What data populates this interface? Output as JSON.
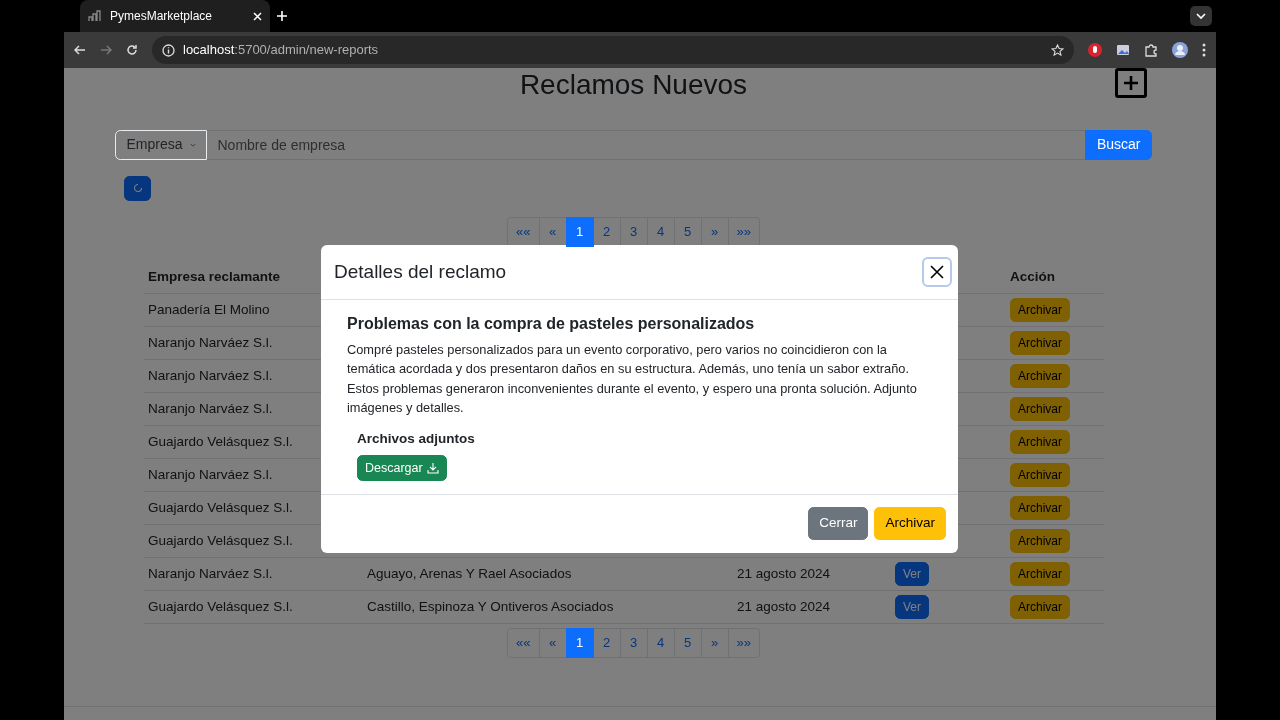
{
  "browser": {
    "tab_title": "PymesMarketplace",
    "url_host": "localhost",
    "url_path": ":5700/admin/new-reports"
  },
  "page": {
    "title": "Reclamos Nuevos",
    "search": {
      "filter": "Empresa",
      "placeholder": "Nombre de empresa",
      "button": "Buscar"
    },
    "pagination_top": [
      {
        "label": "««",
        "selected": false
      },
      {
        "label": "«",
        "selected": false
      },
      {
        "label": "1",
        "selected": true
      },
      {
        "label": "2",
        "selected": false
      },
      {
        "label": "3",
        "selected": false
      },
      {
        "label": "4",
        "selected": false
      },
      {
        "label": "5",
        "selected": false
      },
      {
        "label": "»",
        "selected": false
      },
      {
        "label": "»»",
        "selected": false
      }
    ],
    "table": {
      "headers": {
        "column_1": "Empresa reclamante",
        "column_5": "Acción"
      },
      "rows": [
        {
          "column_1": "Panadería El Molino",
          "action": "Archivar"
        },
        {
          "column_1": "Naranjo Narváez S.l.",
          "action": "Archivar"
        },
        {
          "column_1": "Naranjo Narváez S.l.",
          "action": "Archivar"
        },
        {
          "column_1": "Naranjo Narváez S.l.",
          "action": "Archivar"
        },
        {
          "column_1": "Guajardo Velásquez S.l.",
          "action": "Archivar"
        },
        {
          "column_1": "Naranjo Narváez S.l.",
          "action": "Archivar"
        },
        {
          "column_1": "Guajardo Velásquez S.l.",
          "action": "Archivar"
        },
        {
          "column_1": "Guajardo Velásquez S.l.",
          "action": "Archivar"
        },
        {
          "column_1": "Naranjo Narváez S.l.",
          "column_2": "Aguayo, Arenas Y Rael Asociados",
          "column_3": "21 agosto 2024",
          "view": "Ver",
          "action": "Archivar"
        },
        {
          "column_1": "Guajardo Velásquez S.l.",
          "column_2": "Castillo, Espinoza Y Ontiveros Asociados",
          "column_3": "21 agosto 2024",
          "view": "Ver",
          "action": "Archivar"
        }
      ]
    },
    "pagination_bottom": [
      {
        "label": "««",
        "selected": false
      },
      {
        "label": "«",
        "selected": false
      },
      {
        "label": "1",
        "selected": true
      },
      {
        "label": "2",
        "selected": false
      },
      {
        "label": "3",
        "selected": false
      },
      {
        "label": "4",
        "selected": false
      },
      {
        "label": "5",
        "selected": false
      },
      {
        "label": "»",
        "selected": false
      },
      {
        "label": "»»",
        "selected": false
      }
    ]
  },
  "modal": {
    "title": "Detalles del reclamo",
    "heading": "Problemas con la compra de pasteles personalizados",
    "text": "Compré pasteles personalizados para un evento corporativo, pero varios no coincidieron con la temática acordada y dos presentaron daños en su estructura. Además, uno tenía un sabor extraño. Estos problemas generaron inconvenientes durante el evento, y espero una pronta solución. Adjunto imágenes y detalles.",
    "attachments_label": "Archivos adjuntos",
    "download_button": "Descargar",
    "close_button": "Cerrar",
    "archive_button": "Archivar"
  }
}
